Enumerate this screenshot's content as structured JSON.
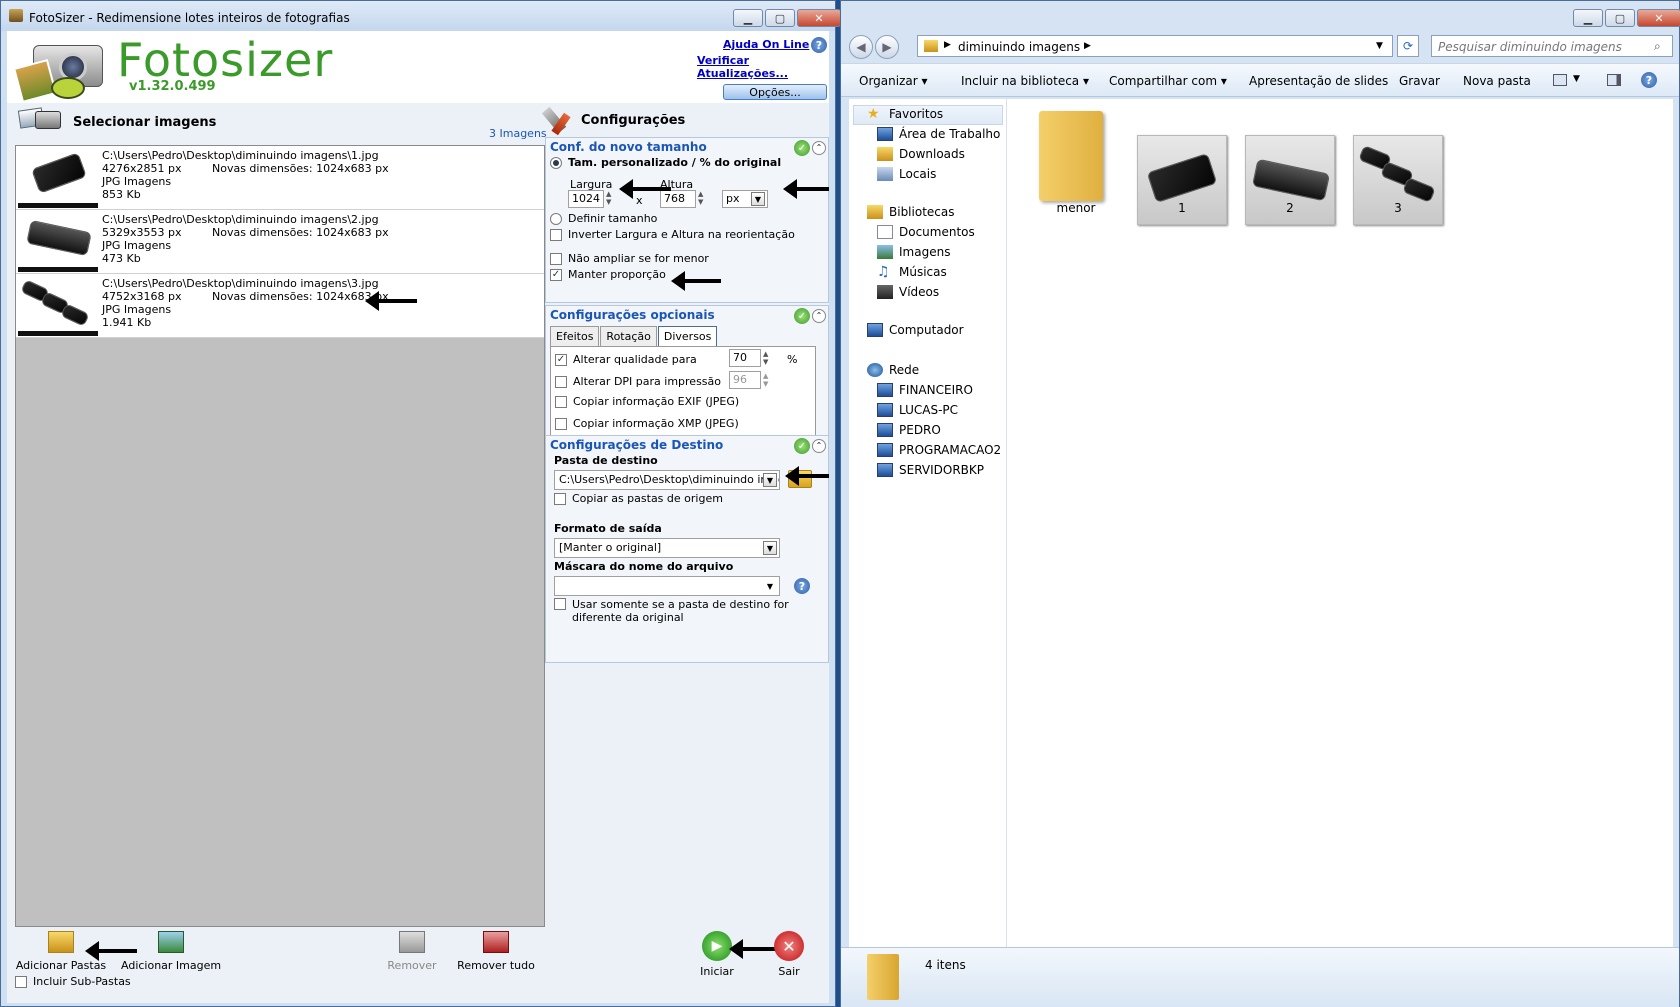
{
  "fotosizer": {
    "title": "FotoSizer - Redimensione lotes inteiros de fotografias",
    "logo_text": "Fotosizer",
    "version": "v1.32.0.499",
    "links": {
      "help": "Ajuda On Line",
      "updates": "Verificar Atualizações..."
    },
    "options_button": "Opções...",
    "select_images": "Selecionar imagens",
    "image_count": "3 Imagens",
    "images": [
      {
        "path": "C:\\Users\\Pedro\\Desktop\\diminuindo imagens\\1.jpg",
        "dims": "4276x2851 px",
        "new_dims": "Novas dimensões: 1024x683 px",
        "type": "JPG Imagens",
        "size": "853 Kb"
      },
      {
        "path": "C:\\Users\\Pedro\\Desktop\\diminuindo imagens\\2.jpg",
        "dims": "5329x3553 px",
        "new_dims": "Novas dimensões: 1024x683 px",
        "type": "JPG Imagens",
        "size": "473 Kb"
      },
      {
        "path": "C:\\Users\\Pedro\\Desktop\\diminuindo imagens\\3.jpg",
        "dims": "4752x3168 px",
        "new_dims": "Novas dimensões: 1024x683 px",
        "type": "JPG Imagens",
        "size": "1.941 Kb"
      }
    ],
    "config": {
      "heading": "Configurações",
      "resize_section": "Conf. do novo tamanho",
      "custom_size": "Tam. personalizado / % do original",
      "width_label": "Largura",
      "height_label": "Altura",
      "width_value": "1024",
      "height_value": "768",
      "x_sep": "x",
      "unit": "px",
      "define_size": "Definir tamanho",
      "invert": "Inverter Largura e Altura na reorientação",
      "no_enlarge": "Não ampliar se for menor",
      "keep_ratio": "Manter proporção",
      "optional_section": "Configurações opcionais",
      "tabs": [
        "Efeitos",
        "Rotação",
        "Diversos"
      ],
      "quality_label": "Alterar qualidade para",
      "quality_value": "70",
      "percent": "%",
      "dpi_label": "Alterar DPI para impressão",
      "dpi_value": "96",
      "exif_label": "Copiar informação EXIF (JPEG)",
      "xmp_label": "Copiar informação XMP (JPEG)",
      "dest_section": "Configurações de Destino",
      "dest_folder_label": "Pasta de destino",
      "dest_folder_value": "C:\\Users\\Pedro\\Desktop\\diminuindo imagens",
      "copy_folders": "Copiar as pastas de origem",
      "output_format_label": "Formato de saída",
      "output_format_value": "[Manter o original]",
      "mask_label": "Máscara do nome do arquivo",
      "mask_value": "",
      "only_if_diff": "Usar somente se a pasta de destino for diferente da original"
    },
    "toolbar": {
      "add_folders": "Adicionar Pastas",
      "add_image": "Adicionar Imagem",
      "remove": "Remover",
      "remove_all": "Remover tudo",
      "include_subfolders": "Incluir Sub-Pastas",
      "start": "Iniciar",
      "exit": "Sair"
    }
  },
  "explorer": {
    "breadcrumb": "diminuindo imagens",
    "search_placeholder": "Pesquisar diminuindo imagens",
    "commands": [
      "Organizar",
      "Incluir na biblioteca",
      "Compartilhar com",
      "Apresentação de slides",
      "Gravar",
      "Nova pasta"
    ],
    "nav": {
      "favorites": "Favoritos",
      "fav_items": [
        "Área de Trabalho",
        "Downloads",
        "Locais"
      ],
      "libraries": "Bibliotecas",
      "lib_items": [
        "Documentos",
        "Imagens",
        "Músicas",
        "Vídeos"
      ],
      "computer": "Computador",
      "network": "Rede",
      "net_items": [
        "FINANCEIRO",
        "LUCAS-PC",
        "PEDRO",
        "PROGRAMACAO2",
        "SERVIDORBKP"
      ]
    },
    "files": [
      "menor",
      "1",
      "2",
      "3"
    ],
    "status": "4 itens"
  }
}
